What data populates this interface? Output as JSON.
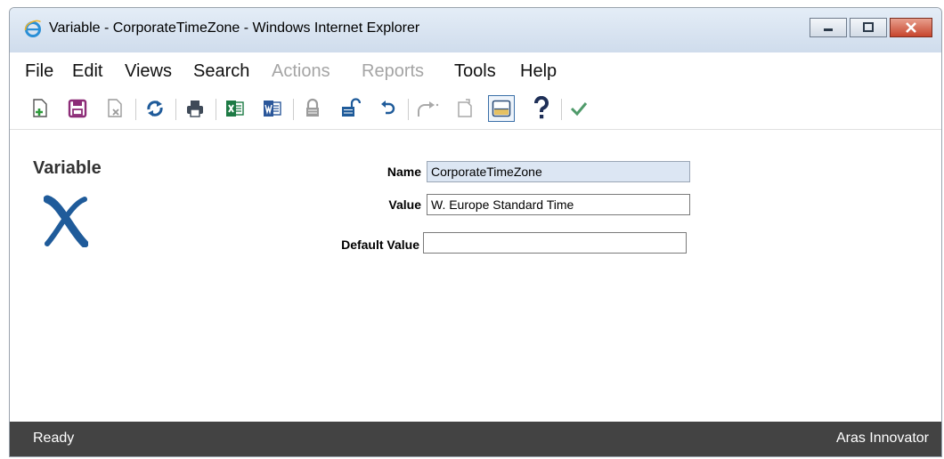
{
  "window": {
    "title": "Variable - CorporateTimeZone - Windows Internet Explorer"
  },
  "menu": {
    "items": [
      {
        "label": "File",
        "enabled": true
      },
      {
        "label": "Edit",
        "enabled": true
      },
      {
        "label": "Views",
        "enabled": true
      },
      {
        "label": "Search",
        "enabled": true
      },
      {
        "label": "Actions",
        "enabled": false
      },
      {
        "label": "Reports",
        "enabled": false
      },
      {
        "label": "Tools",
        "enabled": true
      },
      {
        "label": "Help",
        "enabled": true
      }
    ]
  },
  "toolbar": {
    "icons": [
      "new-icon",
      "save-icon",
      "delete-icon",
      "refresh-icon",
      "print-icon",
      "excel-icon",
      "word-icon",
      "lock-icon",
      "unlock-icon",
      "undo-icon",
      "redo-icon",
      "version-icon",
      "layout-icon",
      "help-icon",
      "done-icon"
    ]
  },
  "form": {
    "title": "Variable",
    "fields": [
      {
        "label": "Name",
        "value": "CorporateTimeZone",
        "readonly": true
      },
      {
        "label": "Value",
        "value": "W. Europe Standard Time",
        "readonly": false
      },
      {
        "label": "Default Value",
        "value": "",
        "readonly": false
      }
    ]
  },
  "status": {
    "left": "Ready",
    "right": "Aras Innovator"
  },
  "colors": {
    "accent": "#1f5b9a",
    "titlebar": "#dbe6f3",
    "statusbar": "#434343",
    "readonly_field": "#dce6f3",
    "disabled_text": "#a5a5a5",
    "checkmark": "#4f9a6a"
  }
}
